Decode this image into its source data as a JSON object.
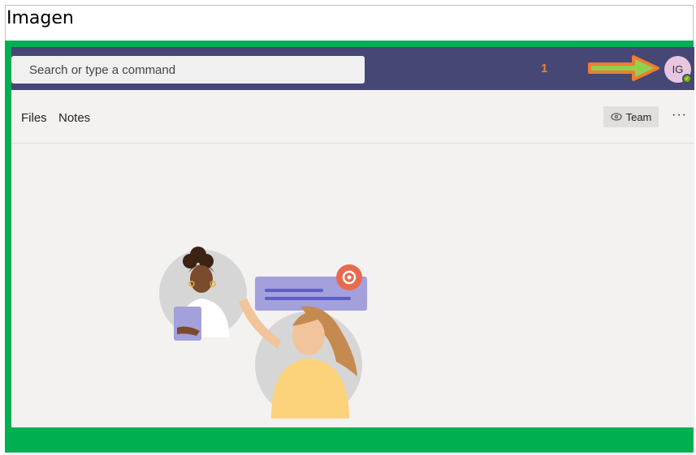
{
  "caption": "Imagen",
  "search": {
    "placeholder": "Search or type a command"
  },
  "annotation": {
    "number": "1"
  },
  "user": {
    "initials": "IG"
  },
  "tabs": [
    {
      "label": "Files"
    },
    {
      "label": "Notes"
    }
  ],
  "actions": {
    "team_label": "Team",
    "more_label": "···"
  },
  "colors": {
    "topbar": "#464775",
    "frame": "#00b050",
    "annotation": "#ed7d31",
    "arrow_fill": "#92d050",
    "status": "#6bb700"
  }
}
